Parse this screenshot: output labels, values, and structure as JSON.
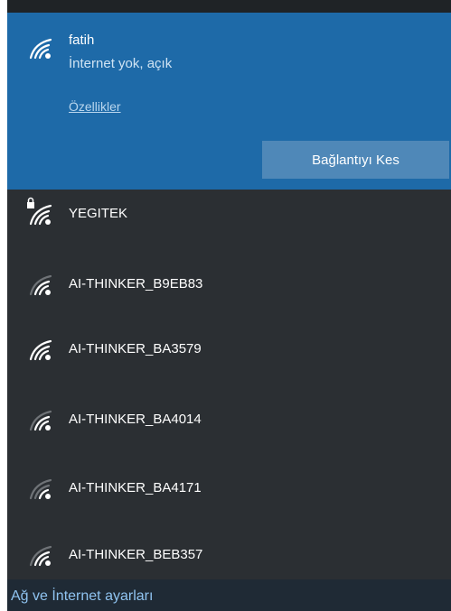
{
  "connected": {
    "name": "fatih",
    "status": "İnternet yok, açık",
    "properties_label": "Özellikler",
    "disconnect_label": "Bağlantıyı Kes",
    "icon": "wifi-icon"
  },
  "networks": [
    {
      "name": "YEGITEK",
      "icon": "wifi-secured-icon",
      "secured": true
    },
    {
      "name": "AI-THINKER_B9EB83",
      "icon": "wifi-icon"
    },
    {
      "name": "AI-THINKER_BA3579",
      "icon": "wifi-icon"
    },
    {
      "name": "AI-THINKER_BA4014",
      "icon": "wifi-icon"
    },
    {
      "name": "AI-THINKER_BA4171",
      "icon": "wifi-icon"
    },
    {
      "name": "AI-THINKER_BEB357",
      "icon": "wifi-icon"
    }
  ],
  "footer": {
    "settings_label": "Ağ ve İnternet ayarları"
  },
  "colors": {
    "panel_bg": "#2b2f33",
    "selected_bg": "#1e6aa8",
    "button_bg": "#4f88b8",
    "link": "#8fc3f0"
  }
}
